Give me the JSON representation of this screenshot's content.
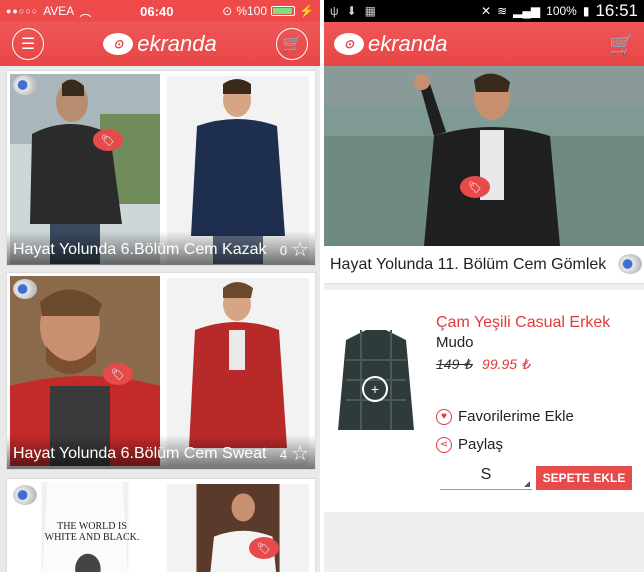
{
  "left": {
    "status": {
      "carrier": "AVEA",
      "time": "06:40",
      "battery": "%100"
    },
    "header": {
      "logo_text": "ekranda",
      "menu_icon": "menu-icon",
      "cart_icon": "cart-icon"
    },
    "cards": [
      {
        "title": "Hayat Yolunda 6.Bölüm Cem Kazak",
        "count": "0"
      },
      {
        "title": "Hayat Yolunda 6.Bölüm Cem Sweat",
        "count": "4"
      },
      {
        "shirt_text_line1": "THE WORLD IS",
        "shirt_text_line2": "WHITE AND BLACK."
      }
    ]
  },
  "right": {
    "status": {
      "battery": "100%",
      "time": "16:51"
    },
    "header": {
      "logo_text": "ekranda",
      "cart_icon": "cart-icon"
    },
    "hero_title": "Hayat Yolunda 11. Bölüm Cem Gömlek",
    "product": {
      "name": "Çam Yeşili Casual Erkek",
      "brand": "Mudo",
      "old_price": "149 ₺",
      "new_price": "99.95 ₺",
      "favorite_label": "Favorilerime Ekle",
      "share_label": "Paylaş",
      "size_selected": "S",
      "add_to_cart_label": "SEPETE EKLE"
    }
  },
  "colors": {
    "brand": "#e84646",
    "cart_yellow": "#ffd84a"
  }
}
